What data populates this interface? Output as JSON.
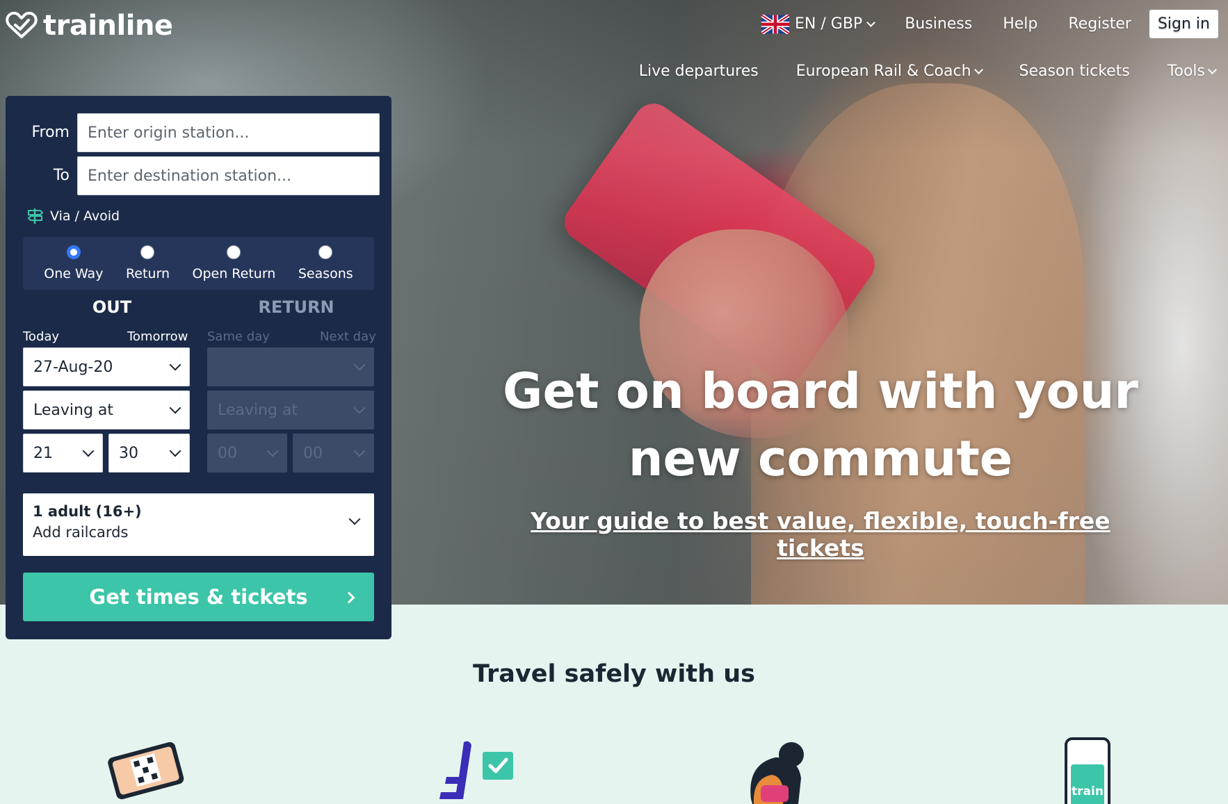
{
  "brand": {
    "logo_text": "trainline"
  },
  "header": {
    "locale": "EN / GBP",
    "links": [
      "Business",
      "Help",
      "Register"
    ],
    "sign_in": "Sign in"
  },
  "subnav": {
    "live_departures": "Live departures",
    "european": "European Rail & Coach",
    "season_tickets": "Season tickets",
    "tools": "Tools"
  },
  "hero": {
    "title_line1": "Get on board with your",
    "title_line2": "new commute",
    "link": "Your guide to best value, flexible, touch-free tickets"
  },
  "search": {
    "from_label": "From",
    "from_placeholder": "Enter origin station...",
    "to_label": "To",
    "to_placeholder": "Enter destination station...",
    "via_label": "Via / Avoid",
    "journey_types": [
      {
        "label": "One Way",
        "selected": true
      },
      {
        "label": "Return",
        "selected": false
      },
      {
        "label": "Open Return",
        "selected": false
      },
      {
        "label": "Seasons",
        "selected": false
      }
    ],
    "out": {
      "heading": "OUT",
      "today": "Today",
      "tomorrow": "Tomorrow",
      "date": "27-Aug-20",
      "time_mode": "Leaving at",
      "hour": "21",
      "minute": "30"
    },
    "return": {
      "heading": "RETURN",
      "same_day": "Same day",
      "next_day": "Next day",
      "date": "",
      "time_mode": "Leaving at",
      "hour": "00",
      "minute": "00"
    },
    "passengers": "1 adult (16+)",
    "railcards": "Add railcards",
    "submit": "Get times & tickets"
  },
  "safety": {
    "title": "Travel safely with us"
  },
  "illustrations": {
    "icons": [
      "eticket-icon",
      "seat-reservation-icon",
      "person-mask-icon",
      "mobile-train-icon"
    ],
    "mobile_label": "train"
  },
  "colors": {
    "panel": "#1b2a48",
    "accent": "#3cc5a8",
    "radio_selected": "#3478f6",
    "section_bg": "#e6f4ef"
  }
}
